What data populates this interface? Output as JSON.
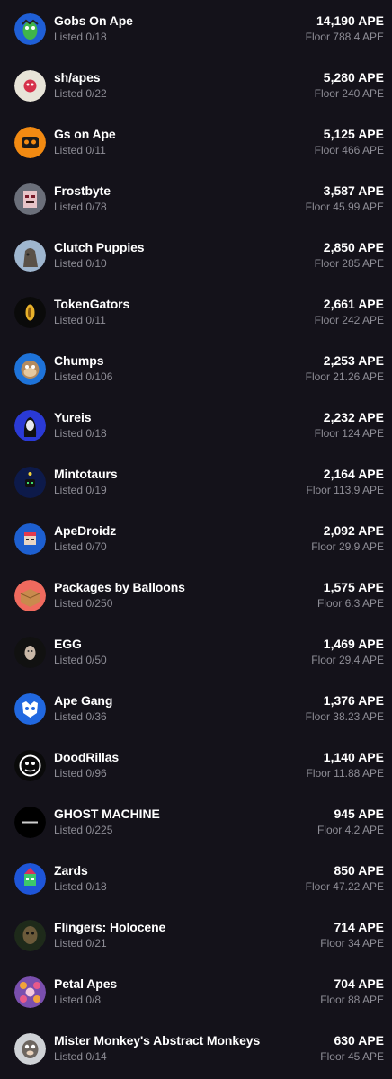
{
  "collections": [
    {
      "name": "Gobs On Ape",
      "listed": "Listed 0/18",
      "volume": "14,190 APE",
      "floor": "Floor 788.4 APE",
      "icon": "gobs-on-ape-avatar-icon",
      "bg": "#1f5fd6",
      "accent": "#3fb54a"
    },
    {
      "name": "sh/apes",
      "listed": "Listed 0/22",
      "volume": "5,280 APE",
      "floor": "Floor 240 APE",
      "icon": "sh-apes-avatar-icon",
      "bg": "#e8e4d8",
      "accent": "#d6314a"
    },
    {
      "name": "Gs on Ape",
      "listed": "Listed 0/11",
      "volume": "5,125 APE",
      "floor": "Floor 466 APE",
      "icon": "gs-on-ape-avatar-icon",
      "bg": "#f28a12",
      "accent": "#1a1a1a"
    },
    {
      "name": "Frostbyte",
      "listed": "Listed 0/78",
      "volume": "3,587 APE",
      "floor": "Floor 45.99 APE",
      "icon": "frostbyte-avatar-icon",
      "bg": "#6b6f7a",
      "accent": "#e8c4c8"
    },
    {
      "name": "Clutch Puppies",
      "listed": "Listed 0/10",
      "volume": "2,850 APE",
      "floor": "Floor 285 APE",
      "icon": "clutch-puppies-avatar-icon",
      "bg": "#9fb6cf",
      "accent": "#5a5148"
    },
    {
      "name": "TokenGators",
      "listed": "Listed 0/11",
      "volume": "2,661 APE",
      "floor": "Floor 242 APE",
      "icon": "tokengators-avatar-icon",
      "bg": "#0a0a0a",
      "accent": "#e8b12a"
    },
    {
      "name": "Chumps",
      "listed": "Listed 0/106",
      "volume": "2,253 APE",
      "floor": "Floor 21.26 APE",
      "icon": "chumps-avatar-icon",
      "bg": "#1e73d9",
      "accent": "#b58b5e"
    },
    {
      "name": "Yureis",
      "listed": "Listed 0/18",
      "volume": "2,232 APE",
      "floor": "Floor 124 APE",
      "icon": "yureis-avatar-icon",
      "bg": "#2a3ad6",
      "accent": "#e9e9ef"
    },
    {
      "name": "Mintotaurs",
      "listed": "Listed 0/19",
      "volume": "2,164 APE",
      "floor": "Floor 113.9 APE",
      "icon": "mintotaurs-avatar-icon",
      "bg": "#0d1a4a",
      "accent": "#3ddc6b"
    },
    {
      "name": "ApeDroidz",
      "listed": "Listed 0/70",
      "volume": "2,092 APE",
      "floor": "Floor 29.9 APE",
      "icon": "apedroidz-avatar-icon",
      "bg": "#1d5fd0",
      "accent": "#e23a4e"
    },
    {
      "name": "Packages by Balloons",
      "listed": "Listed 0/250",
      "volume": "1,575 APE",
      "floor": "Floor 6.3 APE",
      "icon": "packages-by-balloons-avatar-icon",
      "bg": "#f06a5e",
      "accent": "#c98a4d"
    },
    {
      "name": "EGG",
      "listed": "Listed 0/50",
      "volume": "1,469 APE",
      "floor": "Floor 29.4 APE",
      "icon": "egg-avatar-icon",
      "bg": "#111111",
      "accent": "#c9b8a8"
    },
    {
      "name": "Ape Gang",
      "listed": "Listed 0/36",
      "volume": "1,376 APE",
      "floor": "Floor 38.23 APE",
      "icon": "ape-gang-avatar-icon",
      "bg": "#2168e0",
      "accent": "#ffffff"
    },
    {
      "name": "DoodRillas",
      "listed": "Listed 0/96",
      "volume": "1,140 APE",
      "floor": "Floor 11.88 APE",
      "icon": "doodrillas-avatar-icon",
      "bg": "#0a0a0a",
      "accent": "#ffffff"
    },
    {
      "name": "GHOST MACHINE",
      "listed": "Listed 0/225",
      "volume": "945 APE",
      "floor": "Floor 4.2 APE",
      "icon": "ghost-machine-avatar-icon",
      "bg": "#000000",
      "accent": "#cfcfcf"
    },
    {
      "name": "Zards",
      "listed": "Listed 0/18",
      "volume": "850 APE",
      "floor": "Floor 47.22 APE",
      "icon": "zards-avatar-icon",
      "bg": "#1e55d8",
      "accent": "#d8335a"
    },
    {
      "name": "Flingers: Holocene",
      "listed": "Listed 0/21",
      "volume": "714 APE",
      "floor": "Floor 34 APE",
      "icon": "flingers-holocene-avatar-icon",
      "bg": "#1e2a1a",
      "accent": "#6b5a3a"
    },
    {
      "name": "Petal Apes",
      "listed": "Listed 0/8",
      "volume": "704 APE",
      "floor": "Floor 88 APE",
      "icon": "petal-apes-avatar-icon",
      "bg": "#7a4fae",
      "accent": "#f2a33a"
    },
    {
      "name": "Mister Monkey's Abstract Monkeys",
      "listed": "Listed 0/14",
      "volume": "630 APE",
      "floor": "Floor 45 APE",
      "icon": "mister-monkeys-abstract-monkeys-avatar-icon",
      "bg": "#cfd2d6",
      "accent": "#6d6660"
    }
  ]
}
